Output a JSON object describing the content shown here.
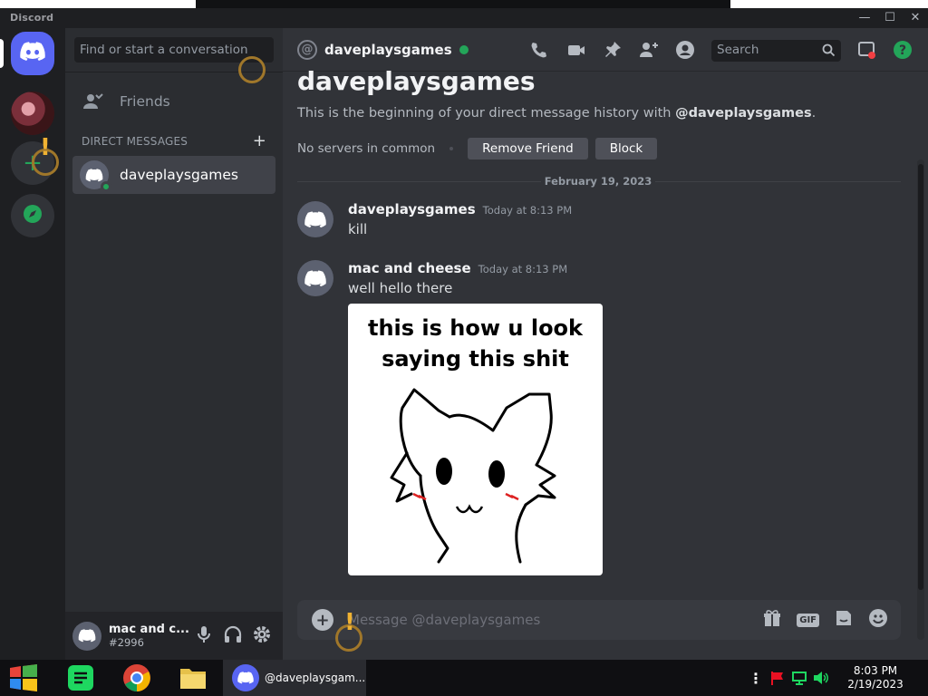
{
  "window": {
    "app_title": "Discord",
    "minimize": "—",
    "maximize": "☐",
    "close": "✕"
  },
  "colors": {
    "blurple": "#5865f2",
    "online": "#23a559",
    "bg_main": "#313338",
    "bg_sidebar": "#2b2d31",
    "bg_guilds": "#1e1f22"
  },
  "guilds": [
    {
      "name": "home",
      "icon": "discord-icon"
    },
    {
      "name": "server-avatar",
      "icon": "avatar"
    },
    {
      "name": "add-server",
      "icon": "plus-icon"
    },
    {
      "name": "explore",
      "icon": "compass-icon"
    }
  ],
  "sidebar": {
    "search_placeholder": "Find or start a conversation",
    "friends_label": "Friends",
    "dm_header": "DIRECT MESSAGES",
    "dm_add": "+",
    "dms": [
      {
        "name": "daveplaysgames",
        "status": "online"
      }
    ]
  },
  "user_panel": {
    "name": "mac and c...",
    "tag": "#2996"
  },
  "header": {
    "channel_name": "daveplaysgames",
    "search_placeholder": "Search"
  },
  "welcome": {
    "title": "daveplaysgames",
    "subtitle_prefix": "This is the beginning of your direct message history with ",
    "subtitle_user": "@daveplaysgames",
    "subtitle_suffix": ".",
    "no_servers": "No servers in common",
    "remove_friend": "Remove Friend",
    "block": "Block"
  },
  "date_divider": "February 19, 2023",
  "messages": [
    {
      "author": "daveplaysgames",
      "time": "Today at 8:13 PM",
      "text": "kill"
    },
    {
      "author": "mac and cheese",
      "time": "Today at 8:13 PM",
      "text": "well hello there"
    }
  ],
  "attachment": {
    "caption_line1": "this is how u look",
    "caption_line2": "saying this shit"
  },
  "composer": {
    "placeholder": "Message @daveplaysgames",
    "gif_label": "GIF"
  },
  "taskbar": {
    "active_window": "@daveplaysgam...",
    "clock_time": "8:03 PM",
    "clock_date": "2/19/2023"
  }
}
